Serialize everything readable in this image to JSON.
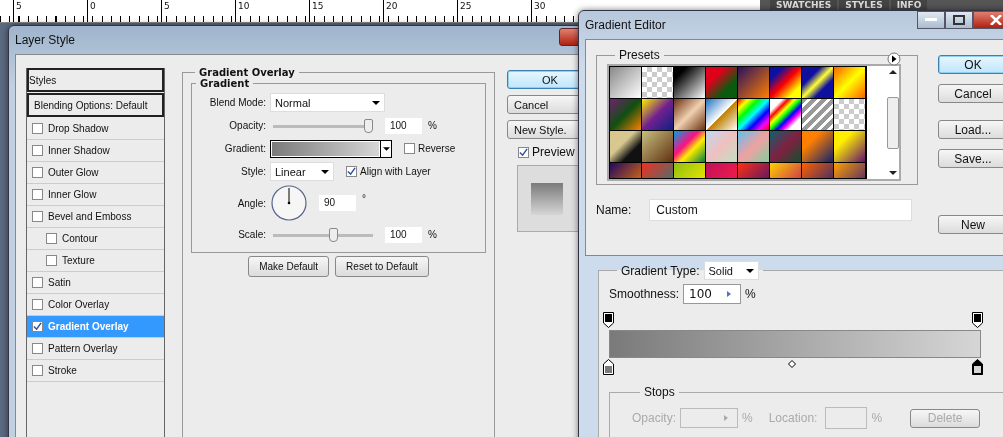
{
  "ruler": {
    "labels": [
      "5",
      "0",
      "5",
      "10",
      "15",
      "20",
      "25",
      "30"
    ]
  },
  "panel_tabs": [
    "SWATCHES",
    "STYLES",
    "INFO"
  ],
  "layer_style": {
    "title": "Layer Style",
    "styles_header": "Styles",
    "styles": [
      {
        "label": "Blending Options: Default",
        "kind": "header",
        "selected": false
      },
      {
        "label": "Drop Shadow",
        "kind": "check",
        "checked": false,
        "selected": false
      },
      {
        "label": "Inner Shadow",
        "kind": "check",
        "checked": false,
        "selected": false
      },
      {
        "label": "Outer Glow",
        "kind": "check",
        "checked": false,
        "selected": false
      },
      {
        "label": "Inner Glow",
        "kind": "check",
        "checked": false,
        "selected": false
      },
      {
        "label": "Bevel and Emboss",
        "kind": "check",
        "checked": false,
        "selected": false,
        "children": [
          {
            "label": "Contour",
            "kind": "check",
            "checked": false,
            "selected": false
          },
          {
            "label": "Texture",
            "kind": "check",
            "checked": false,
            "selected": false
          }
        ]
      },
      {
        "label": "Satin",
        "kind": "check",
        "checked": false,
        "selected": false
      },
      {
        "label": "Color Overlay",
        "kind": "check",
        "checked": false,
        "selected": false
      },
      {
        "label": "Gradient Overlay",
        "kind": "check",
        "checked": true,
        "selected": true
      },
      {
        "label": "Pattern Overlay",
        "kind": "check",
        "checked": false,
        "selected": false
      },
      {
        "label": "Stroke",
        "kind": "check",
        "checked": false,
        "selected": false
      }
    ],
    "section_title": "Gradient Overlay",
    "group_title": "Gradient",
    "blend_mode": {
      "label": "Blend Mode:",
      "value": "Normal"
    },
    "opacity": {
      "label": "Opacity:",
      "level": 1.0,
      "value": "100",
      "unit": "%"
    },
    "gradient": {
      "label": "Gradient:"
    },
    "reverse": {
      "label": "Reverse",
      "checked": false
    },
    "style": {
      "label": "Style:",
      "value": "Linear"
    },
    "align": {
      "label": "Align with Layer",
      "checked": true
    },
    "angle": {
      "label": "Angle:",
      "value": "90",
      "unit": "°"
    },
    "scale": {
      "label": "Scale:",
      "level": 0.62,
      "value": "100",
      "unit": "%"
    },
    "buttons": [
      "Make Default",
      "Reset to Default"
    ],
    "side_buttons": [
      {
        "label": "OK",
        "default": true
      },
      {
        "label": "Cancel",
        "default": false
      },
      {
        "label": "New Style.",
        "default": false
      }
    ],
    "preview": {
      "label": "Preview",
      "checked": true
    }
  },
  "gradient_editor": {
    "title": "Gradient Editor",
    "presets_title": "Presets",
    "side_buttons": [
      {
        "label": "OK",
        "default": true
      },
      {
        "label": "Cancel",
        "default": false
      },
      {
        "label": "Load...",
        "default": false
      },
      {
        "label": "Save...",
        "default": false
      }
    ],
    "name": {
      "label": "Name:",
      "value": "Custom",
      "button": "New"
    },
    "gradient_type": {
      "label": "Gradient Type:",
      "value": "Solid"
    },
    "smoothness": {
      "label": "Smoothness:",
      "value": "100",
      "unit": "%"
    },
    "color_stops": [
      {
        "color": "#7a7a7a",
        "selected": false
      },
      {
        "color": "#d6d6d6",
        "selected": true
      }
    ],
    "stops_title": "Stops",
    "stop_opacity": {
      "label": "Opacity:",
      "unit": "%",
      "disabled": true
    },
    "stop_location": {
      "label": "Location:",
      "unit": "%",
      "disabled": true
    },
    "delete_button": {
      "label": "Delete",
      "disabled": true
    }
  }
}
